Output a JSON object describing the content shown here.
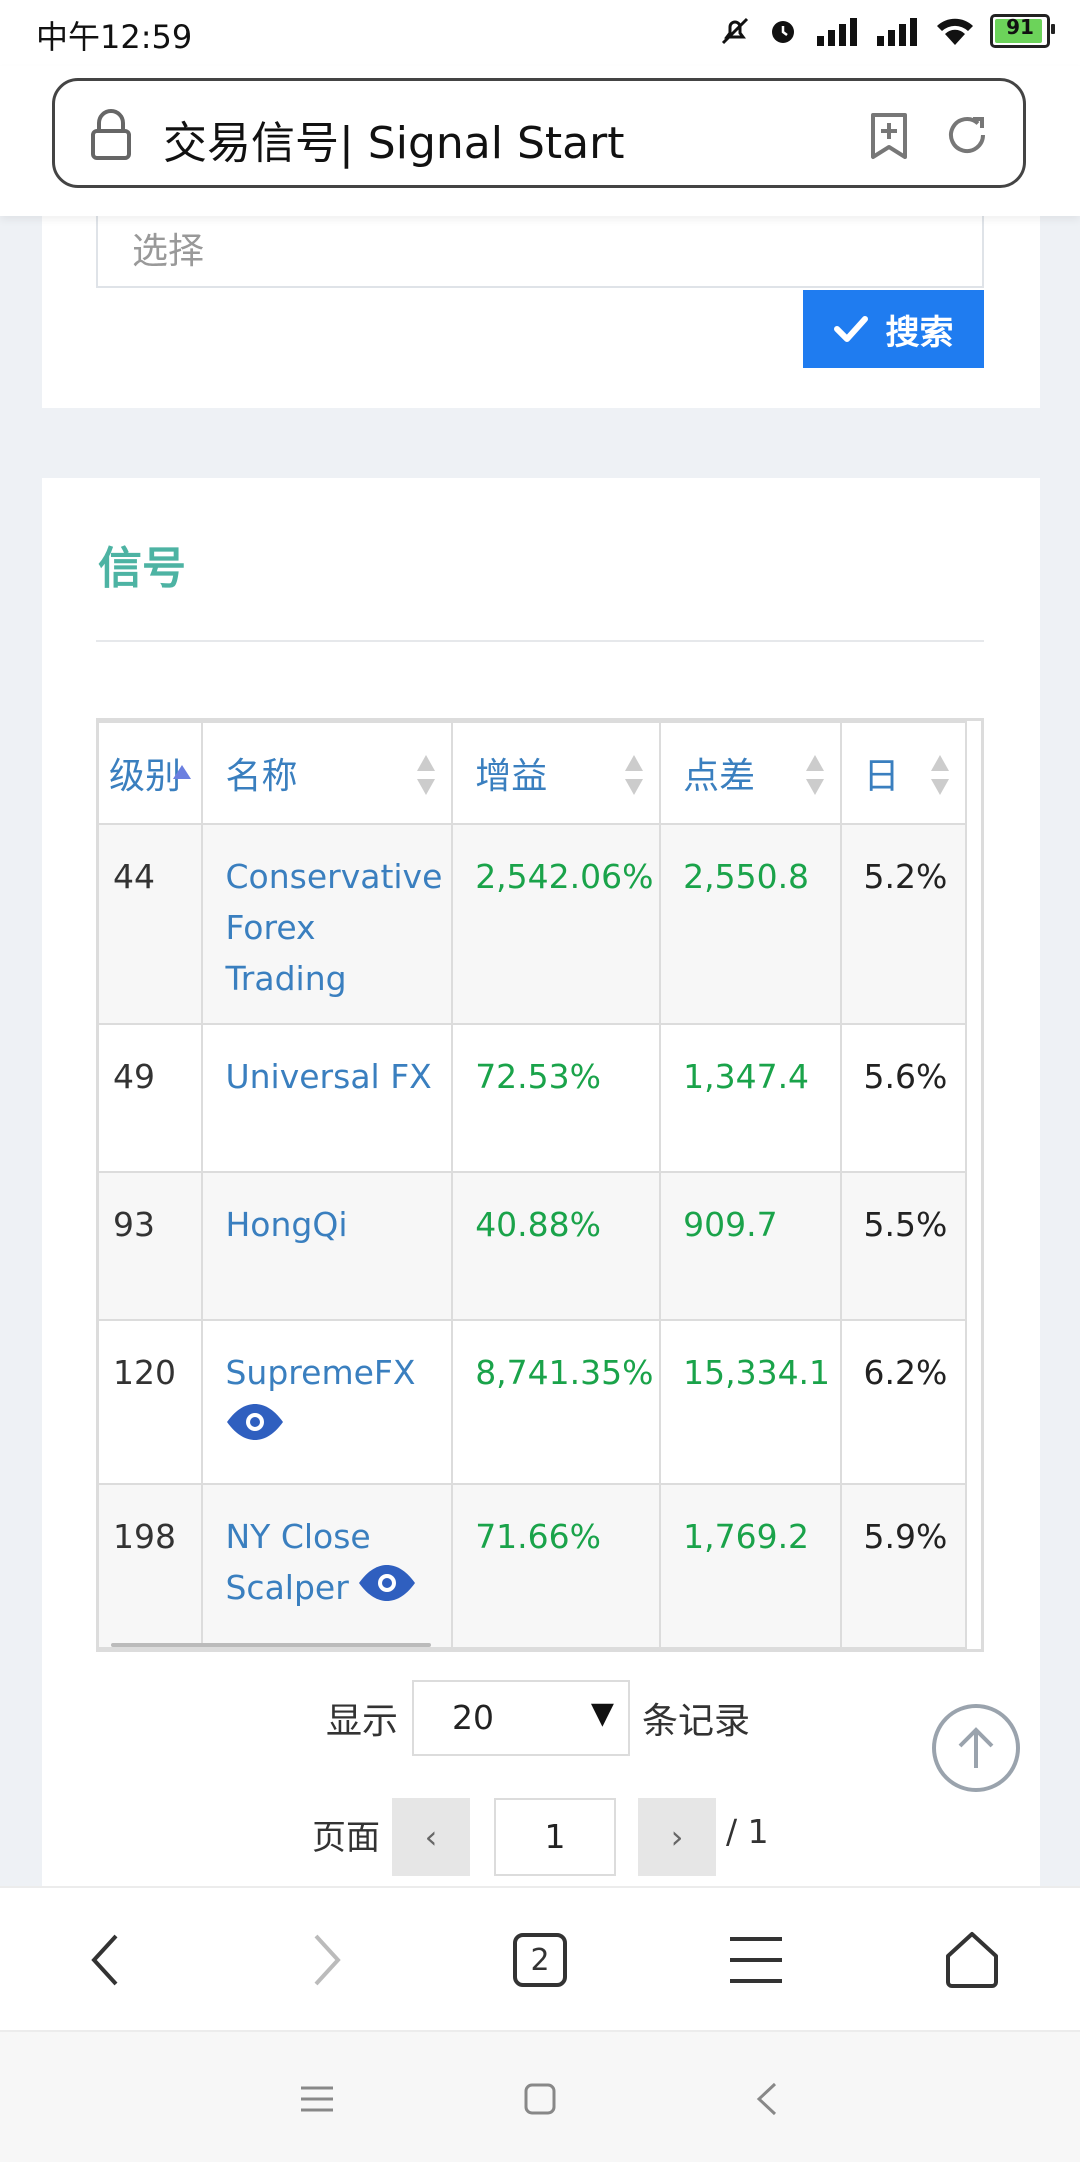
{
  "status_bar": {
    "time": "中午12:59",
    "battery": "91",
    "battery_level": 0.91
  },
  "browser": {
    "title": "交易信号| Signal Start"
  },
  "filter": {
    "select_placeholder": "选择",
    "search_label": "搜索"
  },
  "signals": {
    "title": "信号",
    "columns": [
      "级别",
      "名称",
      "增益",
      "点差",
      "日"
    ],
    "rows": [
      {
        "rank": "44",
        "name_lines": [
          "Conservative",
          "Forex",
          "Trading"
        ],
        "gain": "2,542.06%",
        "pips": "2,550.8",
        "day": "5.2%",
        "eye": false
      },
      {
        "rank": "49",
        "name_lines": [
          "Universal FX"
        ],
        "gain": "72.53%",
        "pips": "1,347.4",
        "day": "5.6%",
        "eye": false
      },
      {
        "rank": "93",
        "name_lines": [
          "HongQi"
        ],
        "gain": "40.88%",
        "pips": "909.7",
        "day": "5.5%",
        "eye": false
      },
      {
        "rank": "120",
        "name_lines": [
          "SupremeFX"
        ],
        "gain": "8,741.35%",
        "pips": "15,334.1",
        "day": "6.2%",
        "eye": true
      },
      {
        "rank": "198",
        "name_lines": [
          "NY Close",
          "Scalper"
        ],
        "gain": "71.66%",
        "pips": "1,769.2",
        "day": "5.9%",
        "eye": true
      }
    ]
  },
  "pagination": {
    "show_label": "显示",
    "page_size": "20",
    "records_label": "条记录",
    "page_label": "页面",
    "prev": "‹",
    "next": "›",
    "current_page": "1",
    "total": "/ 1"
  },
  "browser_nav": {
    "tab_count": "2"
  }
}
